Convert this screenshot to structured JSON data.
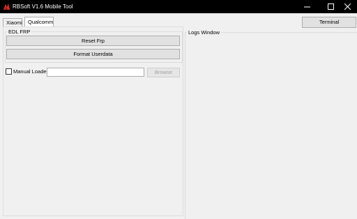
{
  "window": {
    "title": "RBSoft V1.6 Mobile Tool"
  },
  "tabs": [
    {
      "label": "Xiaomi",
      "selected": false
    },
    {
      "label": "Qualcomm",
      "selected": true
    }
  ],
  "edl_frp": {
    "group_label": "EDL FRP",
    "reset_frp_label": "Reset Frp",
    "format_userdata_label": "Format Userdata"
  },
  "loader": {
    "checkbox_label": "Manual Loader",
    "checked": false,
    "path_value": "",
    "browse_label": "Browse",
    "browse_enabled": false
  },
  "logs": {
    "group_label": "Logs Window",
    "content": ""
  },
  "terminal_label": "Terminal",
  "colors": {
    "titlebar": "#000000",
    "window_bg": "#f0f0f0",
    "button_bg": "#e1e1e1",
    "disabled_text": "#a0a0a0"
  },
  "icons": [
    "app-icon",
    "minimize-icon",
    "maximize-icon",
    "close-icon"
  ]
}
